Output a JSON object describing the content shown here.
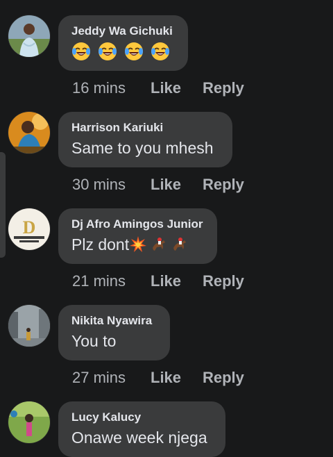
{
  "comments": [
    {
      "author": "Jeddy Wa Gichuki",
      "text": "",
      "emojis": [
        "tears-of-joy-emoji",
        "tears-of-joy-emoji",
        "tears-of-joy-emoji",
        "tears-of-joy-emoji"
      ],
      "time": "16 mins",
      "like_label": "Like",
      "reply_label": "Reply"
    },
    {
      "author": "Harrison Kariuki",
      "text": "Same to you mhesh",
      "time": "30 mins",
      "like_label": "Like",
      "reply_label": "Reply"
    },
    {
      "author": "Dj Afro Amingos Junior",
      "text": "Plz dont",
      "emojis": [
        "collision-emoji",
        "horse-racing-emoji",
        "horse-racing-emoji"
      ],
      "time": "21 mins",
      "like_label": "Like",
      "reply_label": "Reply"
    },
    {
      "author": "Nikita Nyawira",
      "text": "You to",
      "time": "27 mins",
      "like_label": "Like",
      "reply_label": "Reply"
    },
    {
      "author": "Lucy Kalucy",
      "text": "Onawe week njega",
      "time": "",
      "like_label": "",
      "reply_label": ""
    }
  ],
  "colors": {
    "background": "#18191a",
    "bubble": "#3a3b3c",
    "primary_text": "#e4e6eb",
    "secondary_text": "#b0b3b8"
  }
}
